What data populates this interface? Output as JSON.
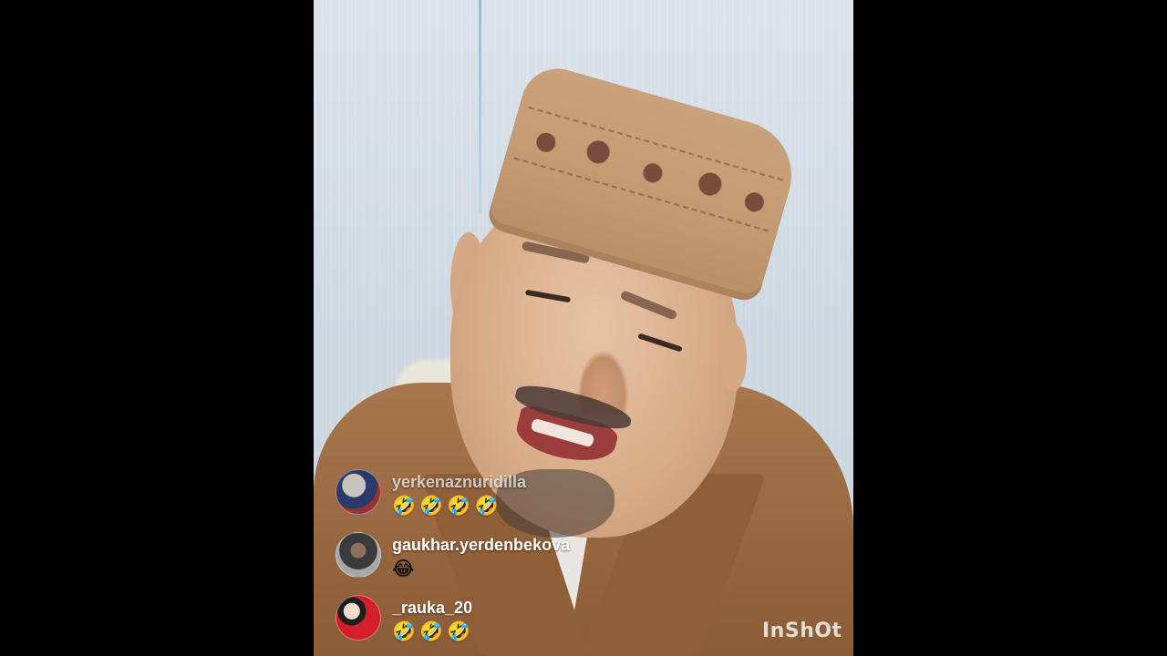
{
  "live": {
    "comments": [
      {
        "username": "yerkenaznuridilla",
        "message": "🤣🤣🤣🤣",
        "avatar_icon": "user-avatar"
      },
      {
        "username": "gaukhar.yerdenbekova",
        "message": "😂",
        "avatar_icon": "user-avatar"
      },
      {
        "username": "_rauka_20",
        "message": "🤣🤣🤣",
        "avatar_icon": "user-avatar"
      }
    ]
  },
  "watermark": {
    "text": "InShOt"
  },
  "colors": {
    "letterbox": "#000000",
    "username": "#ffffff",
    "hat": "#c29a72",
    "jacket": "#96663f"
  }
}
